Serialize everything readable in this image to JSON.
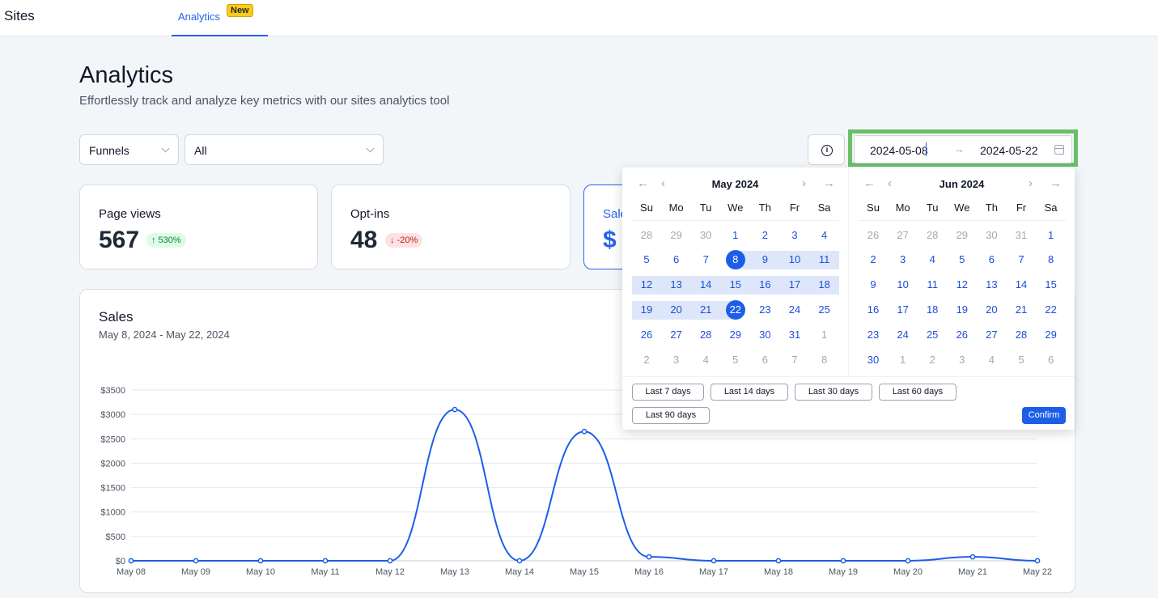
{
  "topbar": {
    "brand": "Sites",
    "tab_label": "Analytics",
    "tab_badge": "New"
  },
  "header": {
    "title": "Analytics",
    "subtitle": "Effortlessly track and analyze key metrics with our sites analytics tool"
  },
  "filters": {
    "type_value": "Funnels",
    "funnel_value": "All"
  },
  "date_range": {
    "start": "2024-05-08",
    "end": "2024-05-22",
    "separator": "→"
  },
  "cards": [
    {
      "label": "Page views",
      "value": "567",
      "change": "↑ 530%",
      "trend": "up"
    },
    {
      "label": "Opt-ins",
      "value": "48",
      "change": "↓ -20%",
      "trend": "down"
    },
    {
      "label": "Sales",
      "value": "$"
    }
  ],
  "sales": {
    "title": "Sales",
    "range": "May 8, 2024 - May 22, 2024"
  },
  "chart_data": {
    "type": "line",
    "x": [
      "May 08",
      "May 09",
      "May 10",
      "May 11",
      "May 12",
      "May 13",
      "May 14",
      "May 15",
      "May 16",
      "May 17",
      "May 18",
      "May 19",
      "May 20",
      "May 21",
      "May 22"
    ],
    "values": [
      0,
      0,
      0,
      0,
      0,
      3100,
      0,
      2650,
      80,
      0,
      0,
      0,
      0,
      80,
      0
    ],
    "yticks": [
      "$0",
      "$500",
      "$1000",
      "$1500",
      "$2000",
      "$2500",
      "$3000",
      "$3500"
    ],
    "ylim": [
      0,
      3500
    ],
    "grid": true,
    "color": "#1d5ee8"
  },
  "calendar": {
    "weekdays": [
      "Su",
      "Mo",
      "Tu",
      "We",
      "Th",
      "Fr",
      "Sa"
    ],
    "nav": {
      "prev_year": "←",
      "prev_month": "‹",
      "next_month": "›",
      "next_year": "→"
    },
    "months": [
      {
        "title": "May 2024",
        "rows": [
          [
            "28",
            "29",
            "30",
            "1",
            "2",
            "3",
            "4"
          ],
          [
            "5",
            "6",
            "7",
            "8",
            "9",
            "10",
            "11"
          ],
          [
            "12",
            "13",
            "14",
            "15",
            "16",
            "17",
            "18"
          ],
          [
            "19",
            "20",
            "21",
            "22",
            "23",
            "24",
            "25"
          ],
          [
            "26",
            "27",
            "28",
            "29",
            "30",
            "31",
            "1"
          ],
          [
            "2",
            "3",
            "4",
            "5",
            "6",
            "7",
            "8"
          ]
        ],
        "first_current_index": 3,
        "last_current_index": 33,
        "selected": [
          "8",
          "22"
        ]
      },
      {
        "title": "Jun 2024",
        "rows": [
          [
            "26",
            "27",
            "28",
            "29",
            "30",
            "31",
            "1"
          ],
          [
            "2",
            "3",
            "4",
            "5",
            "6",
            "7",
            "8"
          ],
          [
            "9",
            "10",
            "11",
            "12",
            "13",
            "14",
            "15"
          ],
          [
            "16",
            "17",
            "18",
            "19",
            "20",
            "21",
            "22"
          ],
          [
            "23",
            "24",
            "25",
            "26",
            "27",
            "28",
            "29"
          ],
          [
            "30",
            "1",
            "2",
            "3",
            "4",
            "5",
            "6"
          ]
        ],
        "first_current_index": 6,
        "last_current_index": 35,
        "selected": []
      }
    ],
    "presets": [
      "Last 7 days",
      "Last 14 days",
      "Last 30 days",
      "Last 60 days",
      "Last 90 days"
    ],
    "confirm": "Confirm"
  }
}
